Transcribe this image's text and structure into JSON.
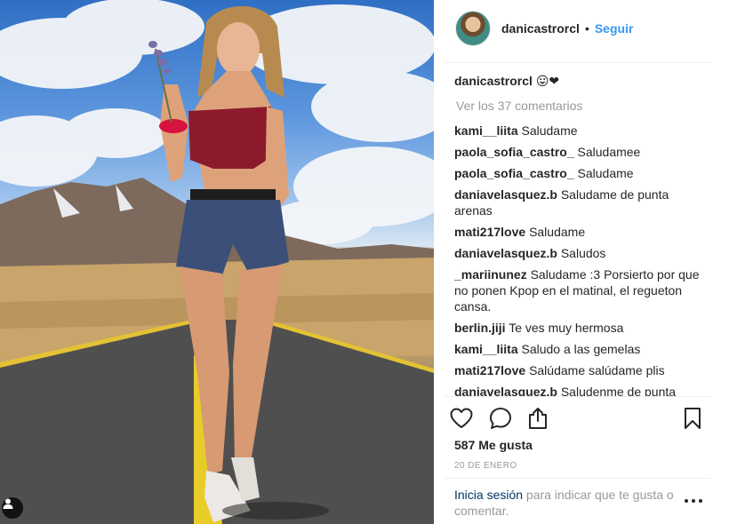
{
  "post": {
    "username": "danicastrorcl",
    "follow_label": "Seguir",
    "separator_dot": "•",
    "caption_user": "danicastrorcl",
    "caption_text": "😛❤",
    "load_more_label": "Ver los 37 comentarios"
  },
  "comments": [
    {
      "user": "kami__liita",
      "text": "Saludame"
    },
    {
      "user": "paola_sofia_castro_",
      "text": "Saludamee"
    },
    {
      "user": "paola_sofia_castro_",
      "text": "Saludame"
    },
    {
      "user": "daniavelasquez.b",
      "text": "Saludame de punta arenas"
    },
    {
      "user": "mati217love",
      "text": "Saludame"
    },
    {
      "user": "daniavelasquez.b",
      "text": "Saludos"
    },
    {
      "user": "_mariinunez",
      "text": "Saludame :3 Porsierto por que no ponen Kpop en el matinal, el regueton cansa."
    },
    {
      "user": "berlin.jiji",
      "text": "Te ves muy hermosa"
    },
    {
      "user": "kami__liita",
      "text": "Saludo a las gemelas"
    },
    {
      "user": "mati217love",
      "text": "Salúdame salúdame plis"
    },
    {
      "user": "daniavelasquez.b",
      "text": "Saludenme de punta arenas"
    }
  ],
  "stats": {
    "likes": "587 Me gusta",
    "date": "20 DE ENERO"
  },
  "footer": {
    "login_link": "Inicia sesión",
    "login_text": " para indicar que te gusta o comentar."
  },
  "icons": {
    "like": "heart-icon",
    "comment": "comment-icon",
    "share": "share-icon",
    "save": "bookmark-icon",
    "more": "more-options-icon",
    "tag": "user-tag-icon"
  },
  "colors": {
    "link": "#3897f0",
    "login_link": "#003569",
    "muted": "#999999",
    "text": "#262626"
  }
}
